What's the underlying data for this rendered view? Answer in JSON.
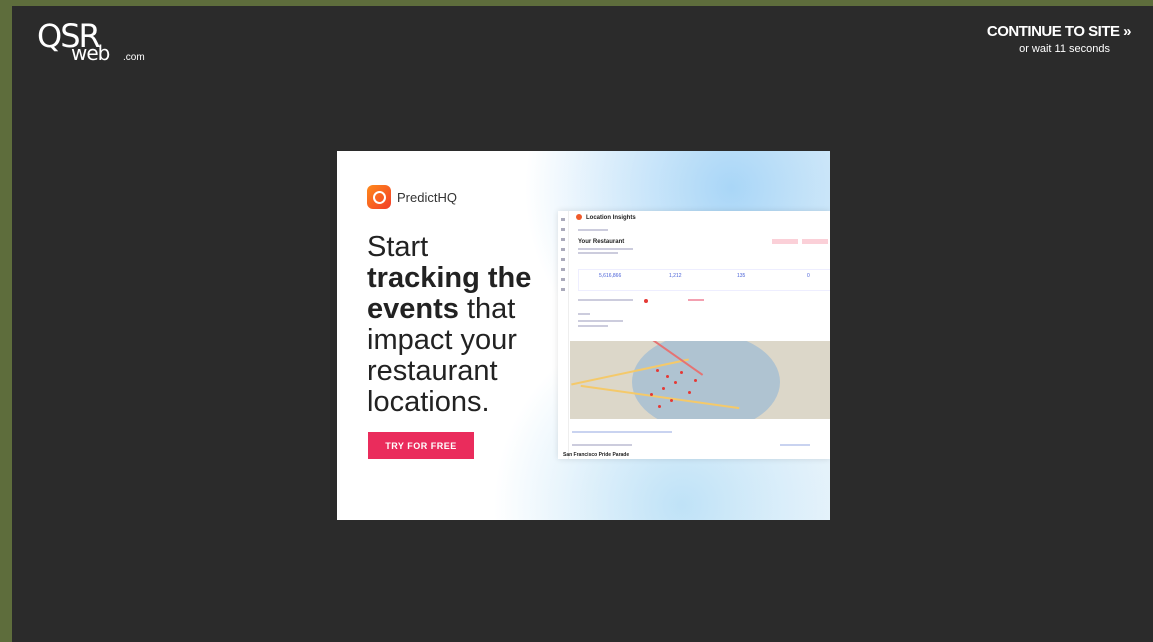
{
  "header": {
    "logo_qsr": "QSR",
    "logo_web": "web",
    "logo_com": ".com",
    "continue_label": "CONTINUE TO SITE »",
    "wait_text": "or wait 11 seconds"
  },
  "ad": {
    "brand_name": "PredictHQ",
    "headline_1": "Start",
    "headline_bold": "tracking the events",
    "headline_2": " that impact your restaurant locations.",
    "cta_label": "TRY FOR FREE",
    "mock_title": "Location Insights",
    "mock_subtitle": "Your Restaurant",
    "mock_stats": [
      "5,616,866",
      "1,212",
      "135",
      "0"
    ],
    "mock_footer": "San Francisco Pride Parade"
  },
  "colors": {
    "page_bg": "#2b2b2b",
    "frame": "#5e6d3c",
    "cta": "#ea2c5c",
    "brand_orange": "#f05a2a"
  }
}
